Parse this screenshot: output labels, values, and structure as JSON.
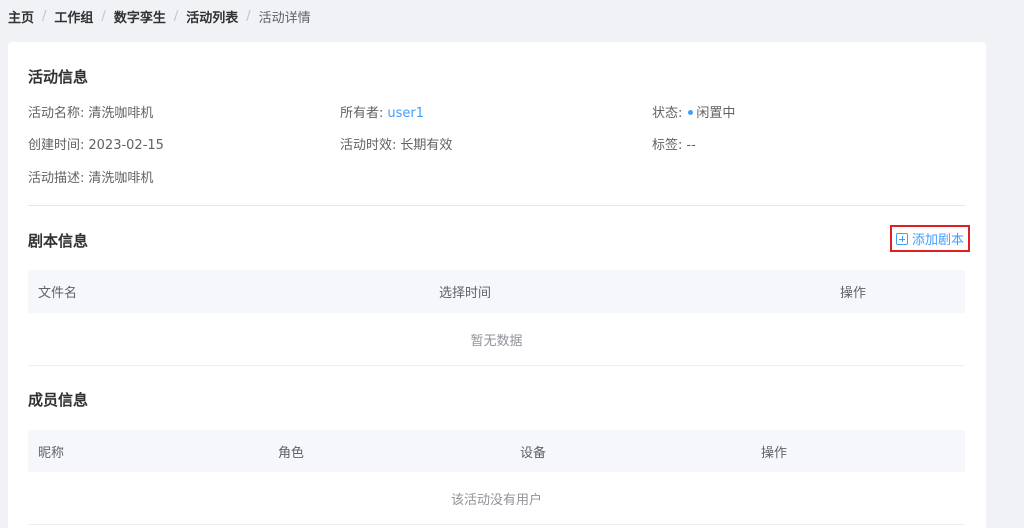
{
  "breadcrumb": {
    "items": [
      "主页",
      "工作组",
      "数字孪生",
      "活动列表"
    ],
    "current": "活动详情",
    "separator": "/"
  },
  "activity_info": {
    "title": "活动信息",
    "name_label": "活动名称:",
    "name_value": "清洗咖啡机",
    "owner_label": "所有者:",
    "owner_value": "user1",
    "status_label": "状态:",
    "status_value": "闲置中",
    "created_label": "创建时间:",
    "created_value": "2023-02-15",
    "validity_label": "活动时效:",
    "validity_value": "长期有效",
    "tags_label": "标签:",
    "tags_value": "--",
    "desc_label": "活动描述:",
    "desc_value": "清洗咖啡机"
  },
  "script_info": {
    "title": "剧本信息",
    "add_button": "添加剧本",
    "columns": [
      "文件名",
      "选择时间",
      "操作"
    ],
    "empty_text": "暂无数据"
  },
  "member_info": {
    "title": "成员信息",
    "columns": [
      "昵称",
      "角色",
      "设备",
      "操作"
    ],
    "empty_text": "该活动没有用户"
  },
  "colors": {
    "accent": "#409eff",
    "highlight_border": "#e02020",
    "page_bg": "#f0f2f5",
    "header_bg": "#f5f7fa"
  }
}
